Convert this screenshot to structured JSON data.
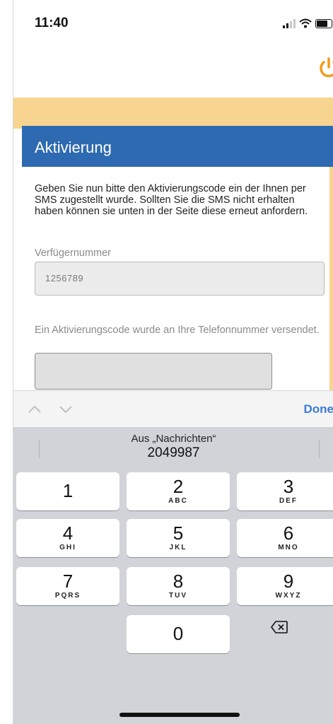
{
  "status_bar": {
    "time": "11:40"
  },
  "colors": {
    "accent_blue": "#2e6ab1",
    "orange_band": "#f7d48f",
    "power_icon": "#f29a1b",
    "done_blue": "#3b7bd5"
  },
  "header": {
    "power_icon": "power-icon"
  },
  "page": {
    "title": "Aktivierung",
    "intro": "Geben Sie nun bitte den Aktivierungscode ein der Ihnen per SMS zugestellt wurde. Sollten Sie die SMS nicht erhalten haben können sie unten in der Seite diese erneut anfordern.",
    "verfuegernummer_label": "Verfügernummer",
    "verfuegernummer_value": "1256789",
    "code_label": "Ein Aktivierungscode wurde an Ihre Telefonnummer versendet.",
    "code_value": ""
  },
  "keyboard_accessory": {
    "done": "Done"
  },
  "keyboard": {
    "suggestion_source": "Aus „Nachrichten“",
    "suggestion_code": "2049987",
    "keys": [
      {
        "num": "1",
        "letters": ""
      },
      {
        "num": "2",
        "letters": "ABC"
      },
      {
        "num": "3",
        "letters": "DEF"
      },
      {
        "num": "4",
        "letters": "GHI"
      },
      {
        "num": "5",
        "letters": "JKL"
      },
      {
        "num": "6",
        "letters": "MNO"
      },
      {
        "num": "7",
        "letters": "PQRS"
      },
      {
        "num": "8",
        "letters": "TUV"
      },
      {
        "num": "9",
        "letters": "WXYZ"
      },
      {
        "num": "0",
        "letters": ""
      }
    ]
  }
}
